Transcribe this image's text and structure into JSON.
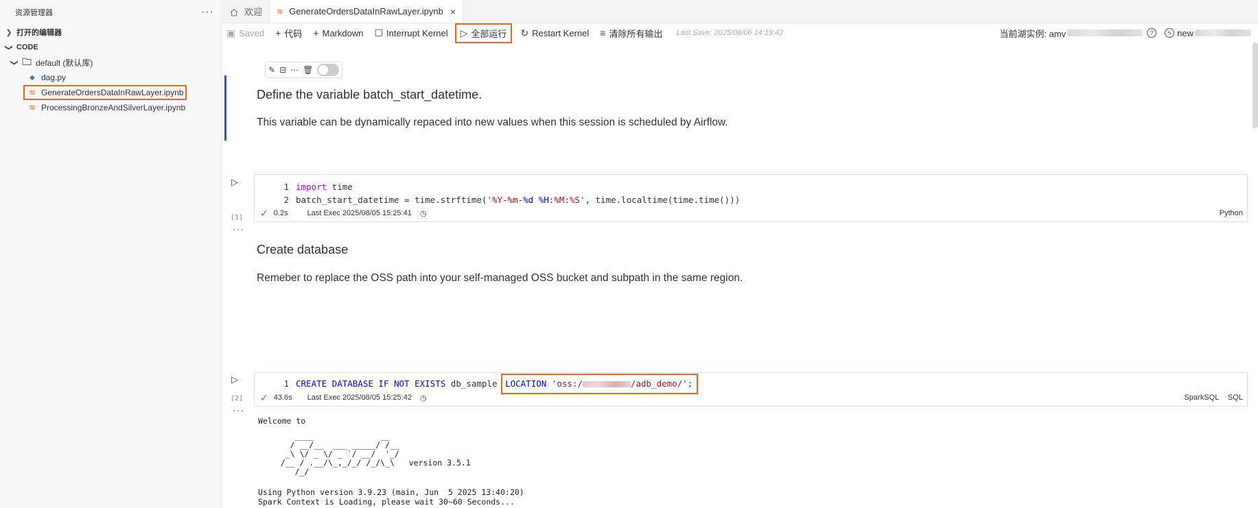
{
  "sidebar": {
    "title": "资源管理器",
    "more": "···",
    "open_editors": "打开的编辑器",
    "section": "CODE",
    "folder": "default (默认库)",
    "files": [
      {
        "name": "dag.py"
      },
      {
        "name": "GenerateOrdersDataInRawLayer.ipynb"
      },
      {
        "name": "ProcessingBronzeAndSilverLayer.ipynb"
      }
    ]
  },
  "tabs": [
    {
      "label": "欢迎"
    },
    {
      "label": "GenerateOrdersDataInRawLayer.ipynb",
      "close": "×"
    }
  ],
  "toolbar": {
    "saved": "Saved",
    "add_code": "代码",
    "add_markdown": "Markdown",
    "interrupt": "Interrupt Kernel",
    "run_all": "全部运行",
    "restart": "Restart Kernel",
    "clear_outputs": "清除所有输出",
    "last_save": "Last Save: 2025/08/06 14:19:42",
    "instance_label": "当前湖实例: amv",
    "new_label": "new"
  },
  "cells": {
    "md1": {
      "heading": "Define the variable batch_start_datetime.",
      "text": "This variable can be dynamically repaced into new values when this session is scheduled by Airflow."
    },
    "code1": {
      "exec_count": "[1]",
      "duration": "0.2s",
      "last_exec": "Last Exec 2025/08/05 15:25:41",
      "language": "Python"
    },
    "md2": {
      "heading": "Create database",
      "text": "Remeber to replace the OSS path into your self-managed OSS bucket and subpath in the same region."
    },
    "code2": {
      "exec_count": "[2]",
      "duration": "43.6s",
      "last_exec": "Last Exec 2025/08/05 15:25:42",
      "language1": "SparkSQL",
      "language2": "SQL"
    },
    "output": {
      "welcome": "Welcome to",
      "logo": "      ____              __\n     / __/__  ___ _____/ /__\n    _\\ \\/ _ \\/ _ `/ __/  '_/\n   /__ / .__/\\_,_/_/ /_/\\_\\   version 3.5.1\n      /_/",
      "python_version": "Using Python version 3.9.23 (main, Jun  5 2025 13:40:20)",
      "spark_loading": "Spark Context is Loading, please wait 30~60 Seconds..."
    }
  },
  "colors": {
    "highlight": "#e8681c",
    "active_cell_bar": "#1a56db",
    "keyword": "#0000ff",
    "string": "#a31515",
    "success": "#2b9a3e"
  }
}
